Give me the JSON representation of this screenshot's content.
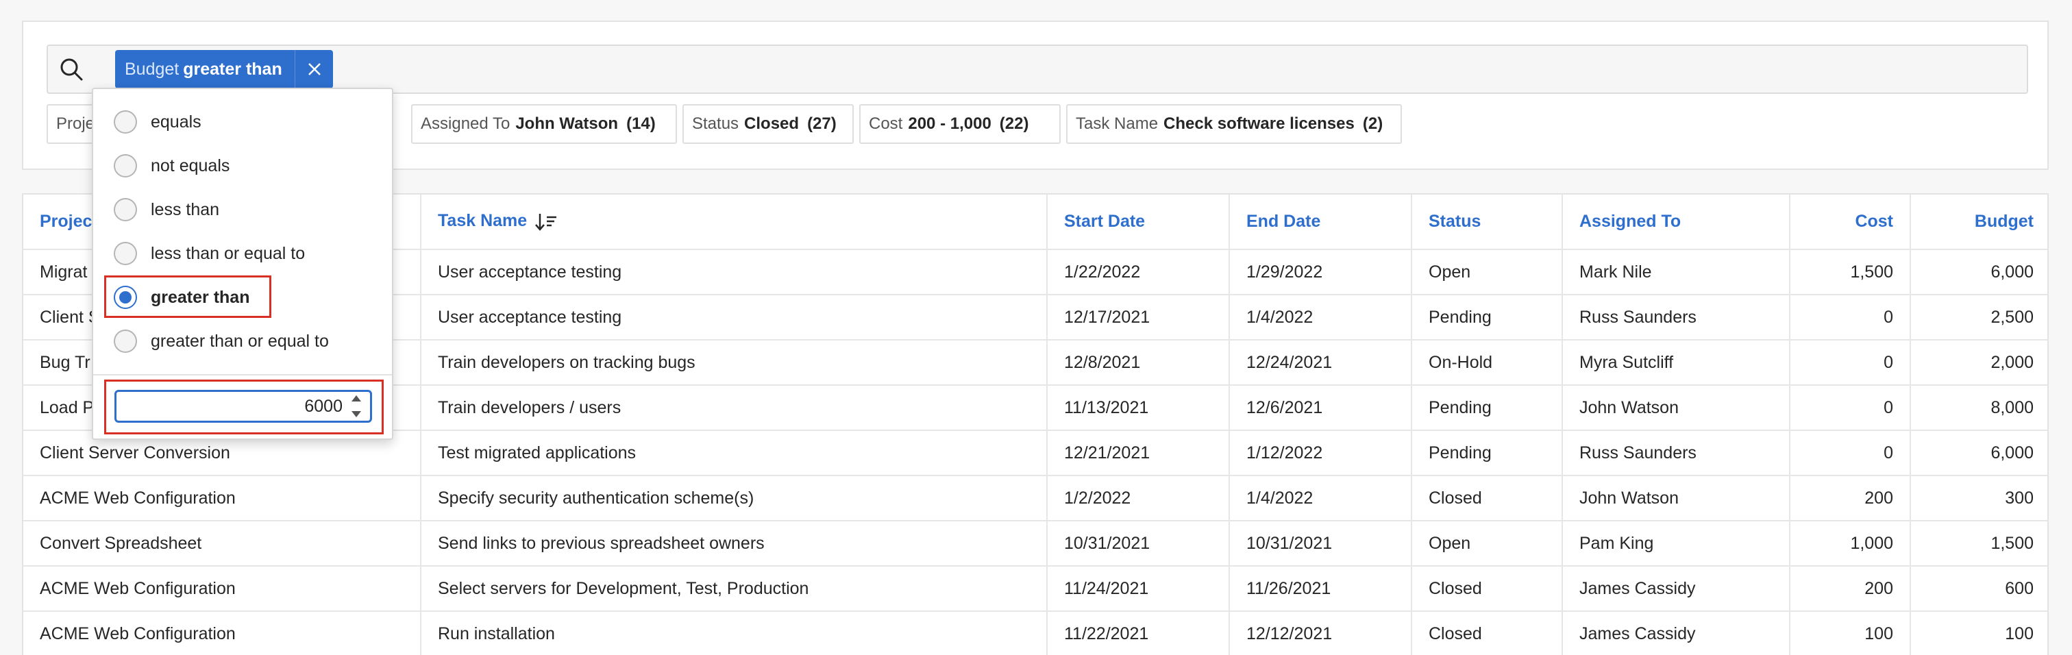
{
  "search": {
    "chip": {
      "field": "Budget",
      "operator": "greater than"
    }
  },
  "facets": [
    {
      "label": "Proje",
      "value": "",
      "count": ""
    },
    {
      "label": "Assigned To",
      "value": "John Watson",
      "count": "(14)"
    },
    {
      "label": "Status",
      "value": "Closed",
      "count": "(27)"
    },
    {
      "label": "Cost",
      "value": "200 - 1,000",
      "count": "(22)"
    },
    {
      "label": "Task Name",
      "value": "Check software licenses",
      "count": "(2)"
    }
  ],
  "filter_popup": {
    "options": [
      {
        "label": "equals",
        "selected": false
      },
      {
        "label": "not equals",
        "selected": false
      },
      {
        "label": "less than",
        "selected": false
      },
      {
        "label": "less than or equal to",
        "selected": false
      },
      {
        "label": "greater than",
        "selected": true
      },
      {
        "label": "greater than or equal to",
        "selected": false
      }
    ],
    "value": "6000"
  },
  "table": {
    "columns": [
      "Projec",
      "Task Name",
      "Start Date",
      "End Date",
      "Status",
      "Assigned To",
      "Cost",
      "Budget"
    ],
    "rows": [
      [
        "Migrat",
        "User acceptance testing",
        "1/22/2022",
        "1/29/2022",
        "Open",
        "Mark Nile",
        "1,500",
        "6,000"
      ],
      [
        "Client S",
        "User acceptance testing",
        "12/17/2021",
        "1/4/2022",
        "Pending",
        "Russ Saunders",
        "0",
        "2,500"
      ],
      [
        "Bug Tr",
        "Train developers on tracking bugs",
        "12/8/2021",
        "12/24/2021",
        "On-Hold",
        "Myra Sutcliff",
        "0",
        "2,000"
      ],
      [
        "Load P",
        "Train developers / users",
        "11/13/2021",
        "12/6/2021",
        "Pending",
        "John Watson",
        "0",
        "8,000"
      ],
      [
        "Client Server Conversion",
        "Test migrated applications",
        "12/21/2021",
        "1/12/2022",
        "Pending",
        "Russ Saunders",
        "0",
        "6,000"
      ],
      [
        "ACME Web Configuration",
        "Specify security authentication scheme(s)",
        "1/2/2022",
        "1/4/2022",
        "Closed",
        "John Watson",
        "200",
        "300"
      ],
      [
        "Convert Spreadsheet",
        "Send links to previous spreadsheet owners",
        "10/31/2021",
        "10/31/2021",
        "Open",
        "Pam King",
        "1,000",
        "1,500"
      ],
      [
        "ACME Web Configuration",
        "Select servers for Development, Test, Production",
        "11/24/2021",
        "11/26/2021",
        "Closed",
        "James Cassidy",
        "200",
        "600"
      ],
      [
        "ACME Web Configuration",
        "Run installation",
        "11/22/2021",
        "12/12/2021",
        "Closed",
        "James Cassidy",
        "100",
        "100"
      ]
    ]
  },
  "colors": {
    "accent": "#2e6fce",
    "highlight": "#d93025"
  },
  "icons": {
    "search": "search-icon",
    "close": "close-icon",
    "sort": "sort-descending-icon"
  }
}
